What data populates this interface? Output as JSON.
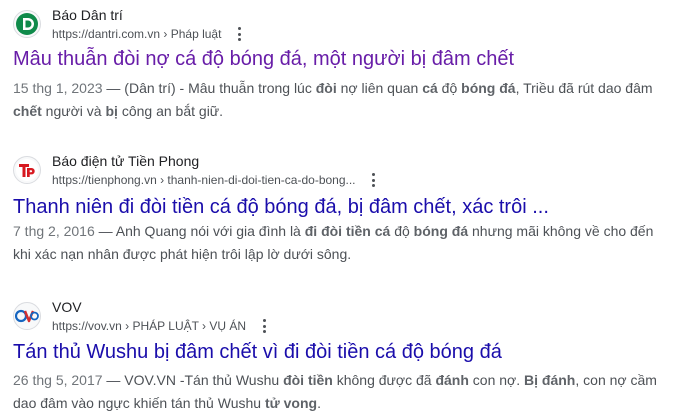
{
  "colors": {
    "visited_link": "#681da8",
    "link": "#1a0dab",
    "snippet": "#4d5156",
    "bold": "#5f6368"
  },
  "results": [
    {
      "site": "Báo Dân trí",
      "url": "https://dantri.com.vn › Pháp luật",
      "title": "Mâu thuẫn đòi nợ cá độ bóng đá, một người bị đâm chết",
      "title_visited": true,
      "date": "15 thg 1, 2023",
      "snippet": [
        {
          "t": " — (Dân trí) - Mâu thuẫn trong lúc "
        },
        {
          "t": "đòi",
          "b": true
        },
        {
          "t": " nợ liên quan "
        },
        {
          "t": "cá",
          "b": true
        },
        {
          "t": " độ "
        },
        {
          "t": "bóng đá",
          "b": true
        },
        {
          "t": ", Triều đã rút dao đâm "
        },
        {
          "t": "chết",
          "b": true
        },
        {
          "t": " người và "
        },
        {
          "t": "bị",
          "b": true
        },
        {
          "t": " công an bắt giữ."
        }
      ],
      "icon": "dantri-favicon"
    },
    {
      "site": "Báo điện tử Tiền Phong",
      "url": "https://tienphong.vn › thanh-nien-di-doi-tien-ca-do-bong...",
      "title": "Thanh niên đi đòi tiền cá độ bóng đá, bị đâm chết, xác trôi ...",
      "title_visited": false,
      "date": "7 thg 2, 2016",
      "snippet": [
        {
          "t": " — Anh Quang nói với gia đình là "
        },
        {
          "t": "đi đòi tiền cá",
          "b": true
        },
        {
          "t": " độ "
        },
        {
          "t": "bóng đá",
          "b": true
        },
        {
          "t": " nhưng mãi không về cho đến khi xác nạn nhân được phát hiện trôi lập lờ dưới sông."
        }
      ],
      "icon": "tienphong-favicon"
    },
    {
      "site": "VOV",
      "url": "https://vov.vn › PHÁP LUẬT › VỤ ÁN",
      "title": "Tán thủ Wushu bị đâm chết vì đi đòi tiền cá độ bóng đá",
      "title_visited": false,
      "date": "26 thg 5, 2017",
      "snippet": [
        {
          "t": " — VOV.VN -Tán thủ Wushu "
        },
        {
          "t": "đòi tiền",
          "b": true
        },
        {
          "t": " không được đã "
        },
        {
          "t": "đánh",
          "b": true
        },
        {
          "t": " con nợ. "
        },
        {
          "t": "Bị đánh",
          "b": true
        },
        {
          "t": ", con nợ cầm dao đâm vào ngực khiến tán thủ Wushu "
        },
        {
          "t": "tử vong",
          "b": true
        },
        {
          "t": "."
        }
      ],
      "icon": "vov-favicon"
    }
  ]
}
